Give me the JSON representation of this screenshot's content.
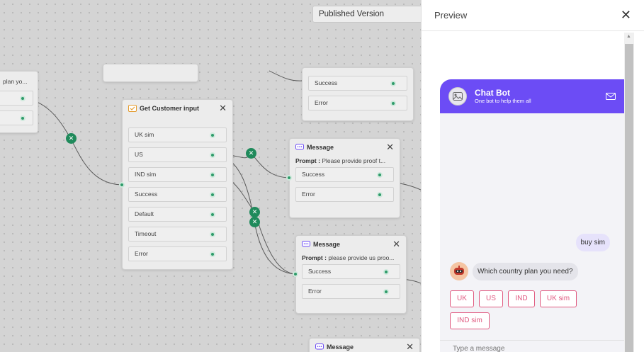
{
  "toolbar": {
    "version_label": "Published Version"
  },
  "canvas": {
    "partial_left": {
      "label": "plan yo..."
    },
    "get_customer_input": {
      "title": "Get Customer input",
      "options": [
        "UK sim",
        "US",
        "IND sim",
        "Success",
        "Default",
        "Timeout",
        "Error"
      ]
    },
    "top_node": {
      "options": [
        "Success",
        "Error"
      ]
    },
    "message1": {
      "title": "Message",
      "prompt_label": "Prompt :",
      "prompt_text": "Please provide proof t...",
      "options": [
        "Success",
        "Error"
      ]
    },
    "message2": {
      "title": "Message",
      "prompt_label": "Prompt :",
      "prompt_text": "please provide us proo...",
      "options": [
        "Success",
        "Error"
      ]
    },
    "message3": {
      "title": "Message"
    }
  },
  "preview": {
    "title": "Preview",
    "chat": {
      "bot_name": "Chat Bot",
      "bot_tagline": "One bot to help them all",
      "user_message": "buy sim",
      "bot_message": "Which country plan you need?",
      "quick_replies": [
        "UK",
        "US",
        "IND",
        "UK sim",
        "IND sim"
      ],
      "input_placeholder": "Type a message"
    }
  },
  "colors": {
    "chat_header": "#6c4cf5",
    "quick_reply": "#e0587f",
    "port_green": "#2e9b6a",
    "user_bubble": "#e6e2fb"
  }
}
